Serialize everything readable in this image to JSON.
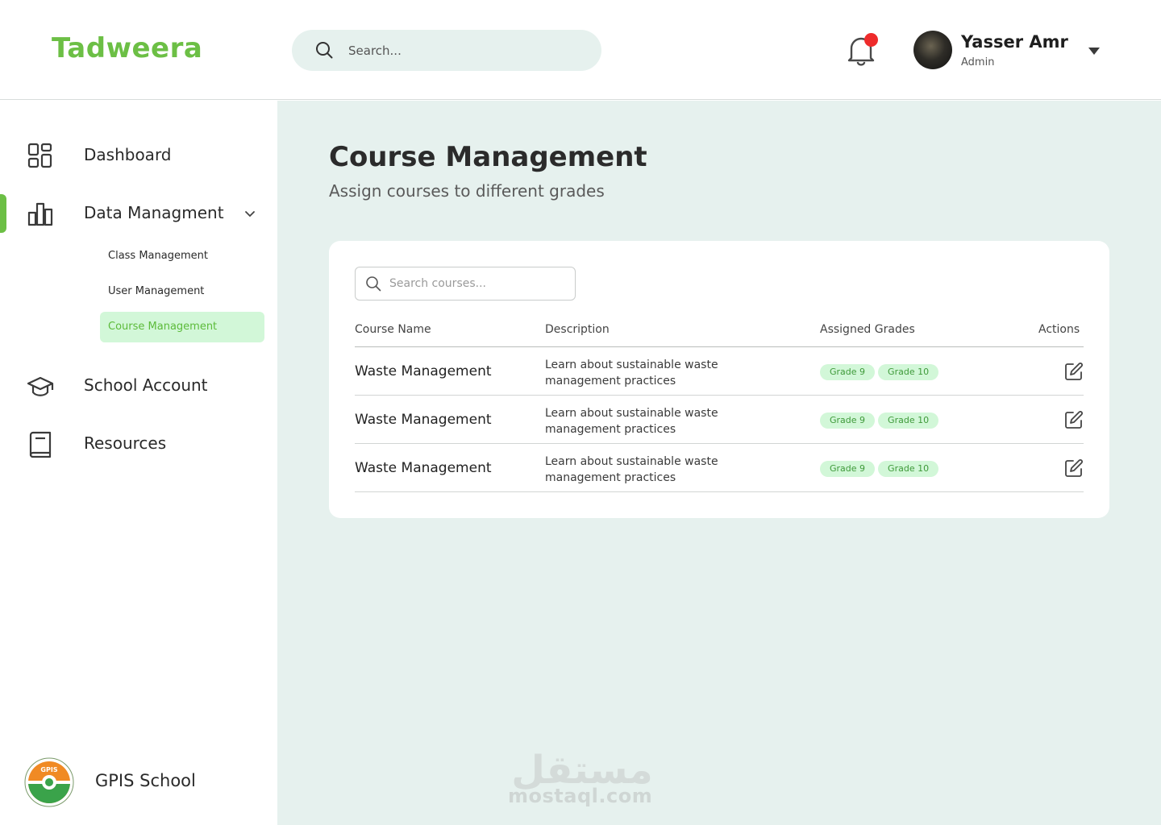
{
  "app": {
    "logo": "Tadweera",
    "search_placeholder": "Search...",
    "accent_color": "#6cbf45",
    "notification_color": "#ee2b2b"
  },
  "user": {
    "name": "Yasser Amr",
    "role": "Admin"
  },
  "sidebar": {
    "items": [
      {
        "label": "Dashboard",
        "icon": "grid-icon"
      },
      {
        "label": "Data Managment",
        "icon": "bar-chart-icon",
        "expanded": true
      },
      {
        "label": "School Account",
        "icon": "graduation-cap-icon"
      },
      {
        "label": "Resources",
        "icon": "book-icon"
      }
    ],
    "sub_items": [
      {
        "label": "Class Management",
        "active": false
      },
      {
        "label": "User Management",
        "active": false
      },
      {
        "label": "Course Management",
        "active": true
      }
    ],
    "school_name": "GPIS School",
    "school_logo_text": "GPIS"
  },
  "main": {
    "title": "Course Management",
    "subtitle": "Assign courses to different grades",
    "search_placeholder": "Search courses...",
    "columns": [
      "Course Name",
      "Description",
      "Assigned Grades",
      "Actions"
    ],
    "rows": [
      {
        "name": "Waste Management",
        "description": "Learn about sustainable waste management practices",
        "grades": [
          "Grade 9",
          "Grade 10"
        ]
      },
      {
        "name": "Waste Management",
        "description": "Learn about sustainable waste management practices",
        "grades": [
          "Grade 9",
          "Grade 10"
        ]
      },
      {
        "name": "Waste Management",
        "description": "Learn about sustainable waste management practices",
        "grades": [
          "Grade 9",
          "Grade 10"
        ]
      }
    ]
  },
  "watermark": {
    "arabic": "مستقل",
    "text": "mostaql.com"
  }
}
